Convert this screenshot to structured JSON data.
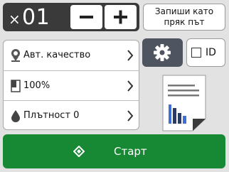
{
  "copies": {
    "prefix": "×",
    "count": "01"
  },
  "stepper": {
    "minus_icon": "minus-icon",
    "plus_icon": "plus-icon"
  },
  "shortcut": {
    "line1": "Запиши като",
    "line2": "пряк път"
  },
  "settings": [
    {
      "label": "Авт. качество",
      "icon": "quality-pin-icon"
    },
    {
      "label": "100%",
      "icon": "enlarge-reduce-icon"
    },
    {
      "label": "Плътност 0",
      "icon": "density-drop-icon"
    }
  ],
  "options": {
    "gear_icon": "gear-icon"
  },
  "id_toggle": {
    "label": "ID",
    "checked": false
  },
  "preview": {
    "icon": "document-preview-icon"
  },
  "start": {
    "label": "Старт",
    "icon": "start-diamond-icon"
  },
  "colors": {
    "background": "#e2e2e2",
    "dark_panel": "#3a3a3a",
    "gear_button": "#4e5560",
    "start_green": "#178834",
    "chart_blue": "#3f6fd6",
    "chart_dark": "#2c3a66",
    "doc_fold": "#3b3b3b"
  }
}
